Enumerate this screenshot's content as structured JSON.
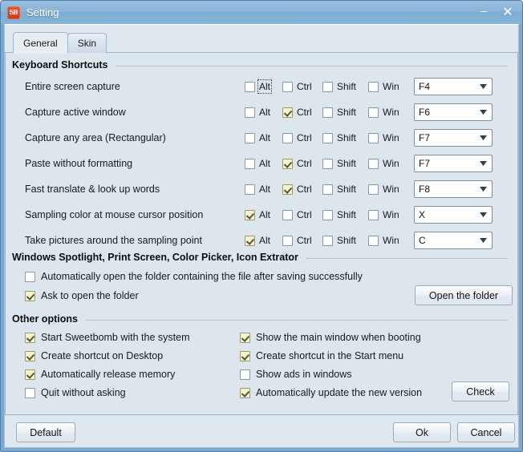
{
  "window": {
    "title": "Setting",
    "icon_label": "SB",
    "icon_name": "app-icon-sweetbomb",
    "minimize_glyph": "–",
    "close_glyph": "✕"
  },
  "tabs": [
    {
      "label": "General",
      "active": true
    },
    {
      "label": "Skin",
      "active": false
    }
  ],
  "groups": {
    "keyboard_shortcuts": {
      "title": "Keyboard Shortcuts",
      "modifier_labels": [
        "Alt",
        "Ctrl",
        "Shift",
        "Win"
      ],
      "rows": [
        {
          "label": "Entire screen capture",
          "alt": false,
          "ctrl": false,
          "shift": false,
          "win": false,
          "key": "F4",
          "focused_modifier": "Alt"
        },
        {
          "label": "Capture active window",
          "alt": false,
          "ctrl": true,
          "shift": false,
          "win": false,
          "key": "F6",
          "focused_modifier": ""
        },
        {
          "label": "Capture any area (Rectangular)",
          "alt": false,
          "ctrl": false,
          "shift": false,
          "win": false,
          "key": "F7",
          "focused_modifier": ""
        },
        {
          "label": "Paste without formatting",
          "alt": false,
          "ctrl": true,
          "shift": false,
          "win": false,
          "key": "F7",
          "focused_modifier": ""
        },
        {
          "label": "Fast translate & look up words",
          "alt": false,
          "ctrl": true,
          "shift": false,
          "win": false,
          "key": "F8",
          "focused_modifier": ""
        },
        {
          "label": "Sampling color at mouse cursor position",
          "alt": true,
          "ctrl": false,
          "shift": false,
          "win": false,
          "key": "X",
          "focused_modifier": ""
        },
        {
          "label": "Take pictures around the sampling point",
          "alt": true,
          "ctrl": false,
          "shift": false,
          "win": false,
          "key": "C",
          "focused_modifier": ""
        }
      ]
    },
    "spotlight": {
      "title": "Windows Spotlight, Print Screen, Color Picker, Icon Extrator",
      "options": [
        {
          "label": "Automatically open the folder containing the file after saving successfully",
          "checked": false
        },
        {
          "label": "Ask to open the folder",
          "checked": true
        }
      ],
      "open_folder_button": "Open the folder"
    },
    "other_options": {
      "title": "Other options",
      "left_column": [
        {
          "label": "Start Sweetbomb with the system",
          "checked": true
        },
        {
          "label": "Create shortcut on Desktop",
          "checked": true
        },
        {
          "label": "Automatically release memory",
          "checked": true
        },
        {
          "label": "Quit without asking",
          "checked": false
        }
      ],
      "right_column": [
        {
          "label": "Show the main window when booting",
          "checked": true
        },
        {
          "label": "Create shortcut in the Start menu",
          "checked": true
        },
        {
          "label": "Show ads in windows",
          "checked": false
        },
        {
          "label": "Automatically update the new version",
          "checked": true
        }
      ],
      "check_button": "Check"
    }
  },
  "footer": {
    "default_label": "Default",
    "ok_label": "Ok",
    "cancel_label": "Cancel"
  },
  "colors": {
    "titlebar_blue": "#8ab4d8",
    "window_border": "#4a7fb0",
    "client_background": "#dde5ed",
    "checkbox_checked_fill": "#f6f3c9",
    "checkbox_check_mark": "#55563e",
    "app_icon_red": "#cf3a1c",
    "group_rule": "#b4c4d4"
  }
}
